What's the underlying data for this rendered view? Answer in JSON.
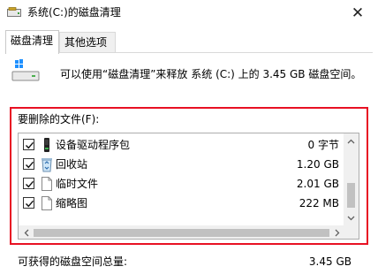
{
  "window": {
    "title": "系统(C:)的磁盘清理",
    "close_glyph": "✕"
  },
  "tabs": [
    {
      "label": "磁盘清理",
      "active": true
    },
    {
      "label": "其他选项",
      "active": false
    }
  ],
  "info": {
    "text": "可以使用“磁盘清理”来释放 系统 (C:) 上的 3.45 GB 磁盘空间。"
  },
  "files_to_delete": {
    "label": "要删除的文件(F):",
    "items": [
      {
        "name": "设备驱动程序包",
        "size": "0 字节",
        "checked": true,
        "icon": "driver-package-icon"
      },
      {
        "name": "回收站",
        "size": "1.20 GB",
        "checked": true,
        "icon": "recycle-bin-icon"
      },
      {
        "name": "临时文件",
        "size": "2.01 GB",
        "checked": true,
        "icon": "file-icon"
      },
      {
        "name": "缩略图",
        "size": "222 MB",
        "checked": true,
        "icon": "file-icon"
      }
    ]
  },
  "total": {
    "label": "可获得的磁盘空间总量:",
    "value": "3.45 GB"
  },
  "colors": {
    "highlight_border": "#e81123",
    "scrollbar_track": "#f0f0f0",
    "scrollbar_thumb": "#c1c1c1"
  }
}
